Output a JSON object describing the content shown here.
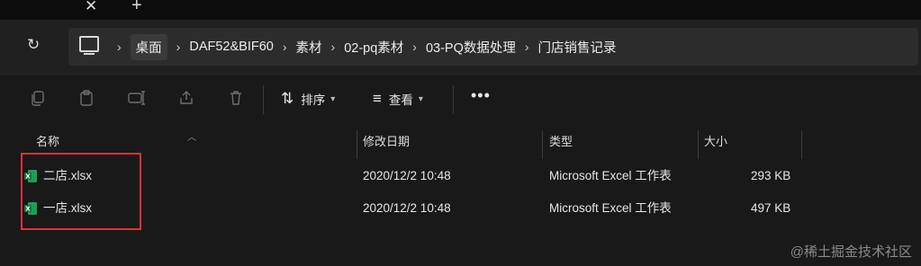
{
  "tabstrip": {
    "close_glyph": "✕",
    "new_glyph": "+"
  },
  "nav": {
    "refresh_glyph": "↻",
    "breadcrumb": [
      "桌面",
      "DAF52&BIF60",
      "素材",
      "02-pq素材",
      "03-PQ数据处理",
      "门店销售记录"
    ],
    "separator": "›"
  },
  "toolbar": {
    "sort_label": "排序",
    "view_label": "查看",
    "more_label": "•••",
    "icons": [
      "copy-icon",
      "paste-icon",
      "rename-icon",
      "share-icon",
      "delete-icon",
      "sort-icon",
      "view-icon"
    ]
  },
  "columns": {
    "name": "名称",
    "modified": "修改日期",
    "type": "类型",
    "size": "大小"
  },
  "files": [
    {
      "name": "二店.xlsx",
      "modified": "2020/12/2 10:48",
      "type": "Microsoft Excel 工作表",
      "size": "293 KB"
    },
    {
      "name": "一店.xlsx",
      "modified": "2020/12/2 10:48",
      "type": "Microsoft Excel 工作表",
      "size": "497 KB"
    }
  ],
  "watermark": "@稀土掘金技术社区",
  "colors": {
    "accent_red": "#e0303a",
    "excel_green": "#1f9d55"
  }
}
